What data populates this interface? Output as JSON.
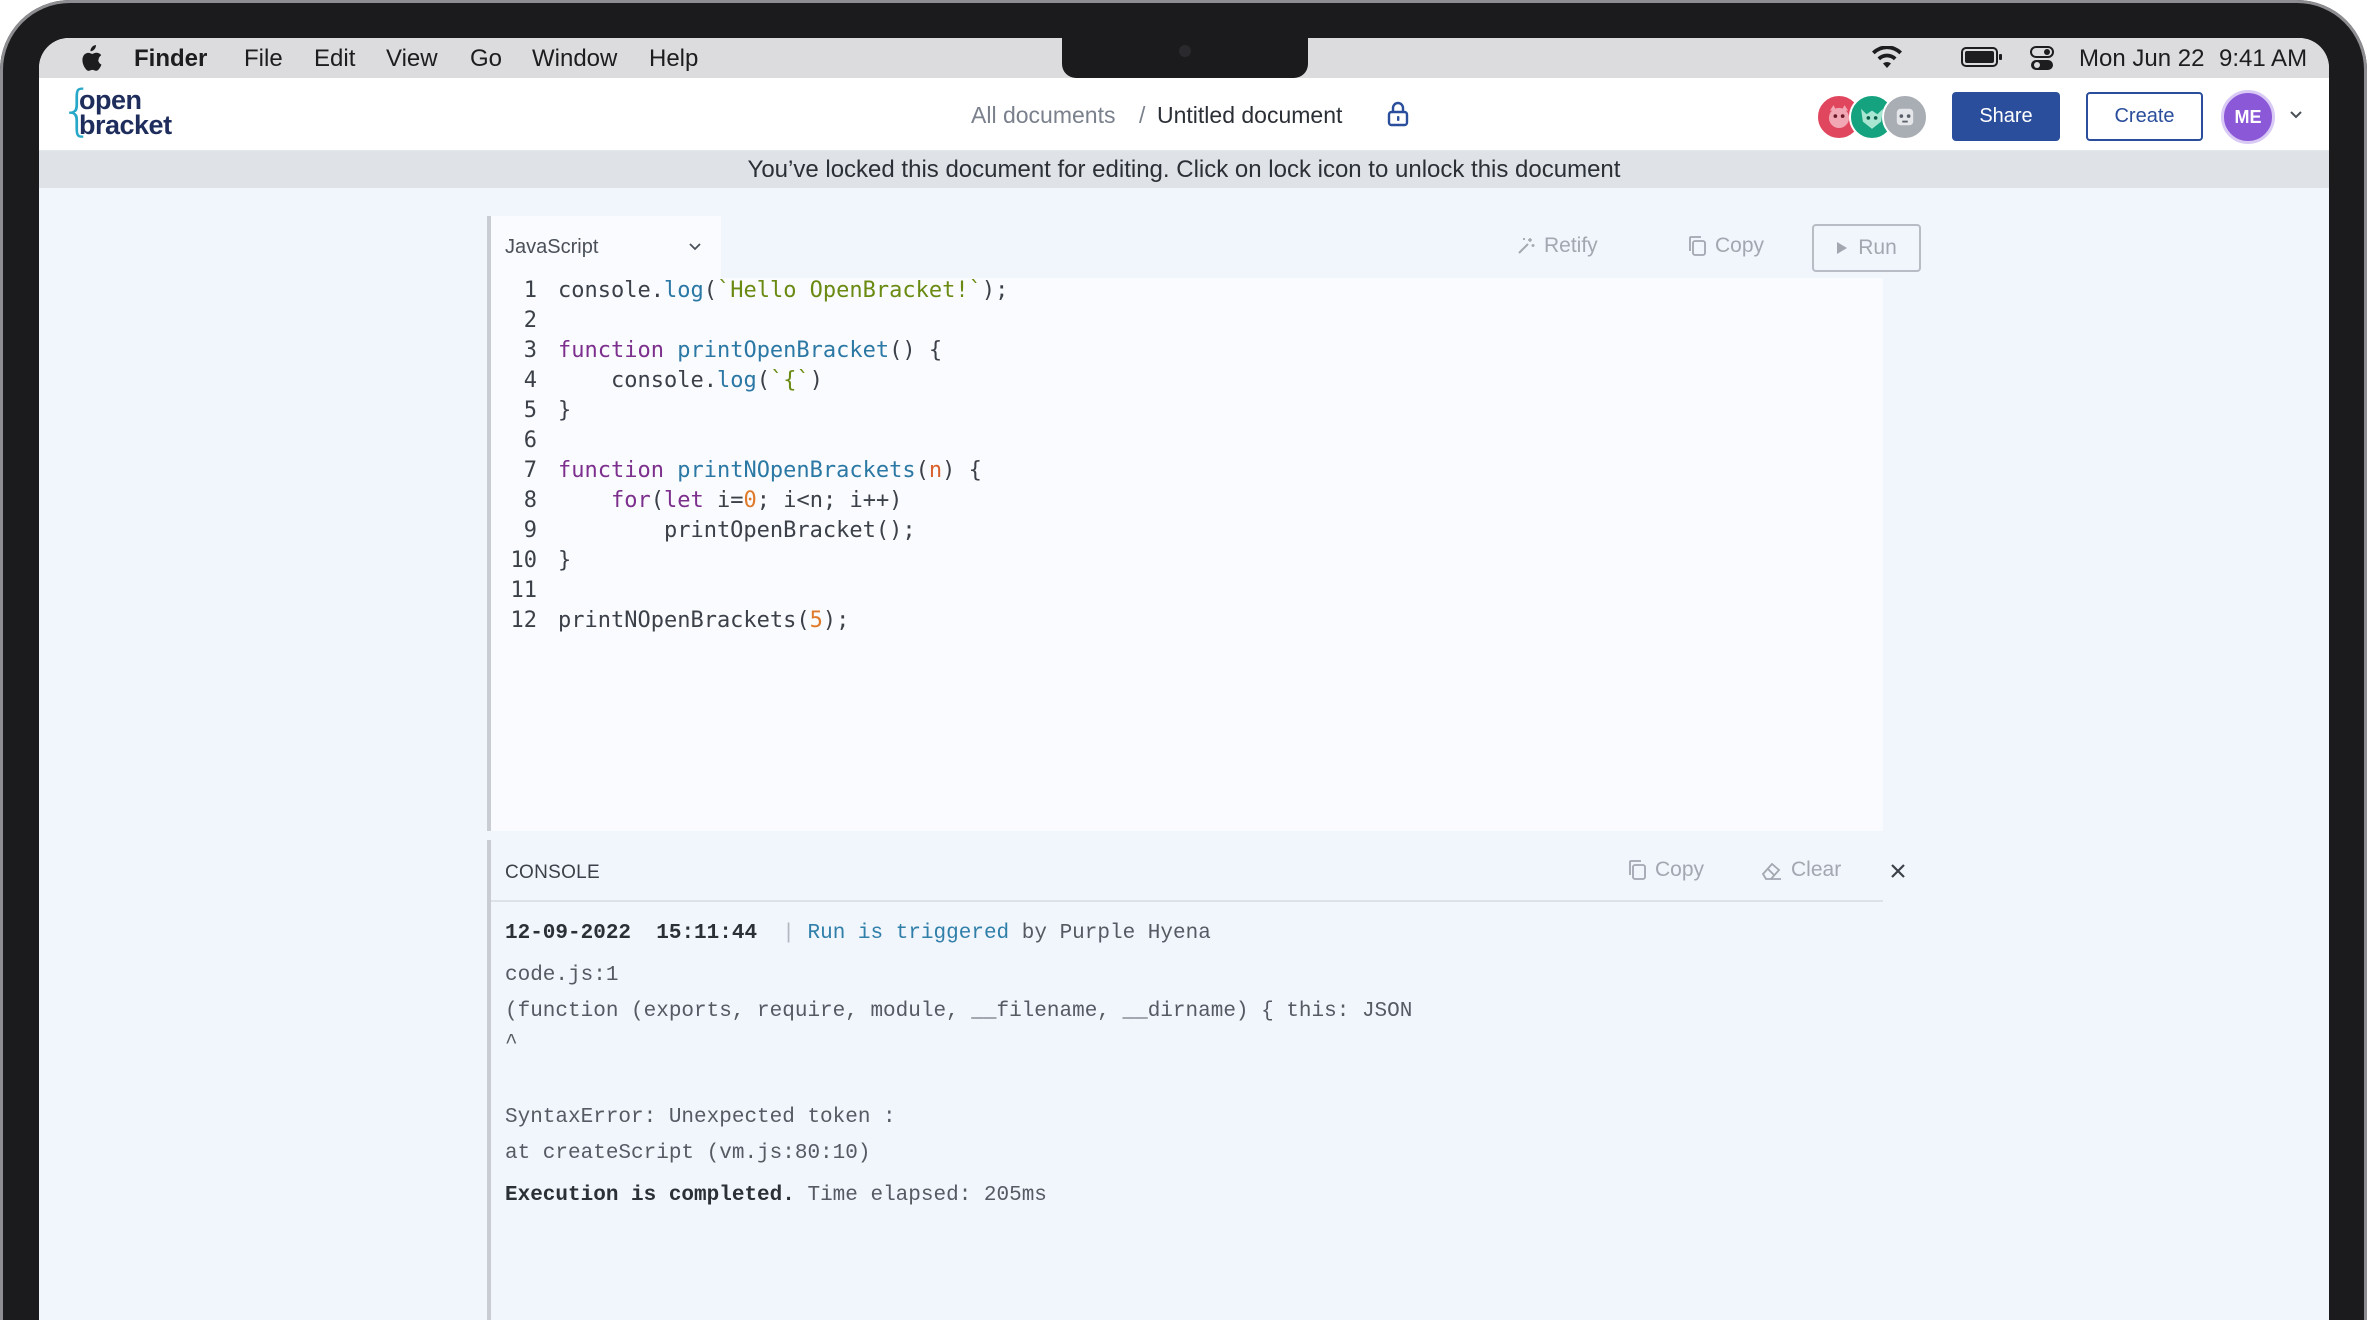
{
  "menubar": {
    "app_name": "Finder",
    "items": [
      "File",
      "Edit",
      "View",
      "Go",
      "Window",
      "Help"
    ],
    "clock": {
      "date": "Mon Jun 22",
      "time": "9:41 AM"
    }
  },
  "header": {
    "logo": {
      "line1": "open",
      "line2": "bracket"
    },
    "breadcrumb": {
      "root": "All documents",
      "separator": "/",
      "current": "Untitled document"
    },
    "share_label": "Share",
    "create_label": "Create",
    "user_initials": "ME"
  },
  "banner": {
    "text": "You’ve locked this document for editing. Click on lock icon to unlock this document"
  },
  "editor": {
    "language": "JavaScript",
    "toolbar": {
      "retify": "Retify",
      "copy": "Copy",
      "run": "Run"
    },
    "line_numbers": [
      "1",
      "2",
      "3",
      "4",
      "5",
      "6",
      "7",
      "8",
      "9",
      "10",
      "11",
      "12"
    ]
  },
  "console": {
    "title": "CONSOLE",
    "copy_label": "Copy",
    "clear_label": "Clear",
    "run_header": {
      "date": "12-09-2022",
      "time": "15:11:44",
      "separator": "|",
      "event": "Run is triggered",
      "by": "by Purple Hyena"
    },
    "output_lines": [
      "code.js:1",
      "(function (exports, require, module, __filename, __dirname) { this: JSON",
      "^",
      "",
      "SyntaxError: Unexpected token :",
      "at createScript (vm.js:80:10)"
    ],
    "footer": {
      "status": "Execution is completed.",
      "elapsed": "Time elapsed: 205ms"
    }
  },
  "colors": {
    "accent": "#2a4e9b",
    "logo_brace": "#27a8c9",
    "logo_text": "#1e2d5c",
    "banner_bg": "#dfe3e8",
    "user_avatar": "#8b58d8",
    "keyword": "#7c2f8d",
    "function": "#2c78a5",
    "string": "#6a8a12",
    "number": "#e07a2a"
  },
  "icons": [
    "apple-icon",
    "wifi-icon",
    "battery-icon",
    "control-center-icon",
    "lock-icon",
    "chevron-down-icon",
    "wand-icon",
    "copy-icon",
    "play-icon",
    "eraser-icon",
    "close-icon"
  ]
}
